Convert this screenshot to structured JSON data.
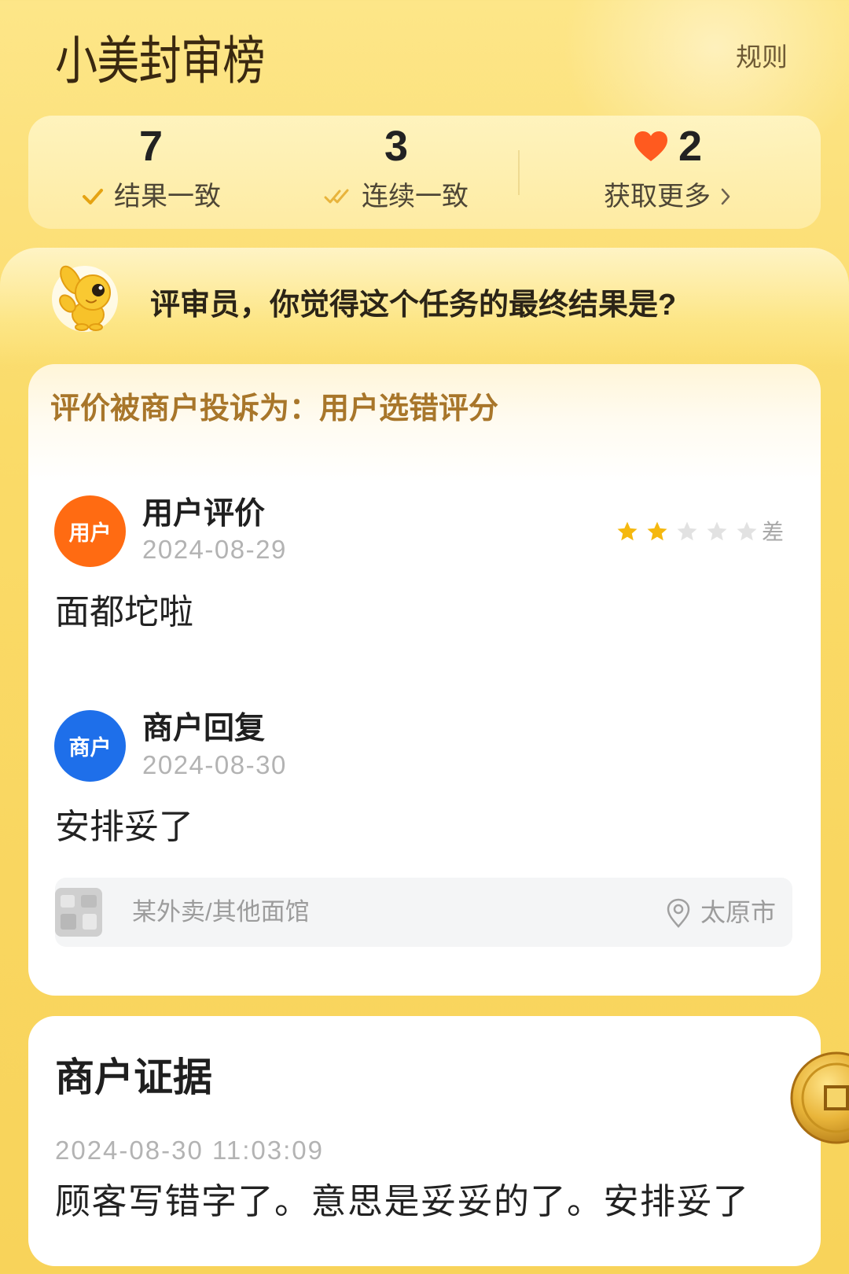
{
  "header": {
    "title": "小美封审榜",
    "rules_label": "规则"
  },
  "stats": {
    "matched": {
      "value": "7",
      "label": "结果一致",
      "icon": "check-icon"
    },
    "streak": {
      "value": "3",
      "label": "连续一致",
      "icon": "double-check-icon"
    },
    "hearts": {
      "value": "2",
      "label": "获取更多",
      "icon": "heart-icon",
      "link_icon": "chevron-right-icon"
    }
  },
  "prompt": {
    "mascot": "mascot-icon",
    "question": "评审员，你觉得这个任务的最终结果是?"
  },
  "review": {
    "complaint": "评价被商户投诉为：用户选错评分",
    "user": {
      "avatar_label": "用户",
      "name": "用户评价",
      "date": "2024-08-29",
      "rating": 2,
      "rating_max": 5,
      "rating_label": "差",
      "text": "面都坨啦"
    },
    "merchant": {
      "avatar_label": "商户",
      "name": "商户回复",
      "date": "2024-08-30",
      "text": "安排妥了"
    },
    "store": {
      "icon": "store-icon",
      "category": "某外卖/其他面馆",
      "location_icon": "location-pin-icon",
      "city": "太原市"
    }
  },
  "evidence": {
    "title": "商户证据",
    "timestamp": "2024-08-30 11:03:09",
    "text": "顾客写错字了。意思是妥妥的了。安排妥了"
  },
  "floating": {
    "icon": "coin-icon"
  },
  "colors": {
    "background": "#FADC6A",
    "accent_gold": "#E5A312",
    "heart": "#FF5A1F",
    "user_avatar": "#FF6B12",
    "merchant_avatar": "#1E6FEA",
    "complaint_text": "#A8762A",
    "star_filled": "#F5B80F",
    "star_empty": "#E2E2E2"
  }
}
